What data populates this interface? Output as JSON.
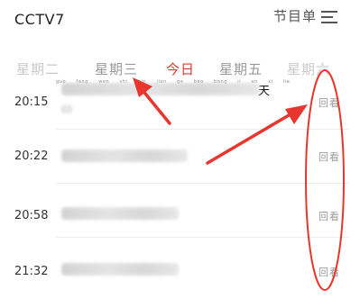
{
  "header": {
    "channel": "CCTV7",
    "program_list_label": "节目单"
  },
  "day_tabs": [
    {
      "label": "星期二"
    },
    {
      "label": "星期三"
    },
    {
      "label": "今日"
    },
    {
      "label": "星期五"
    },
    {
      "label": "星期六"
    }
  ],
  "pinyin_hint": [
    "guo",
    "fang",
    "wen",
    "shi",
    "pin",
    "jian",
    "ge",
    "bao",
    "bang",
    "ji",
    "an",
    "xi",
    "lie"
  ],
  "tian_char": "天",
  "schedule": [
    {
      "time": "20:15",
      "action": "回看"
    },
    {
      "time": "20:22",
      "action": "回看"
    },
    {
      "time": "20:58",
      "action": "回看"
    },
    {
      "time": "21:32",
      "action": "回看"
    }
  ],
  "colors": {
    "active_tab": "#d43b33",
    "annotation": "#e8352e"
  },
  "icons": {
    "menu": "menu-icon"
  }
}
